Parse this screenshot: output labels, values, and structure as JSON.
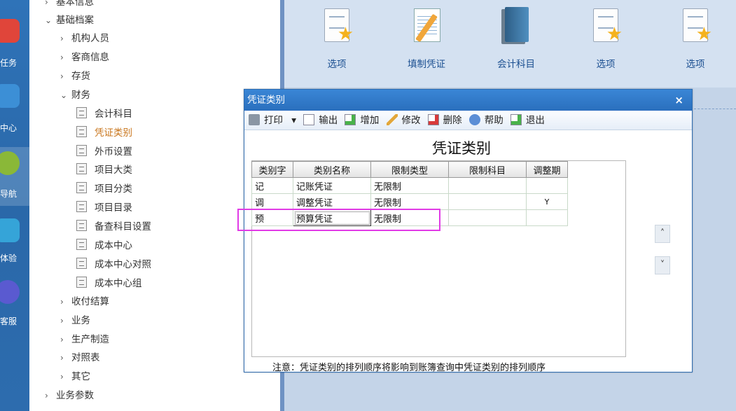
{
  "rail": {
    "items": [
      {
        "label": "任务",
        "color": "#e0453a"
      },
      {
        "label": "中心",
        "color": "#3c8fd6"
      },
      {
        "label": "导航",
        "color": "#8ab838"
      },
      {
        "label": "体验",
        "color": "#35a4d8"
      },
      {
        "label": "客服",
        "color": "#5a5ad0"
      }
    ]
  },
  "tree": {
    "items": [
      {
        "label": "基本信息",
        "chev": "›",
        "level": 1
      },
      {
        "label": "基础档案",
        "chev": "⌄",
        "level": 1
      },
      {
        "label": "机构人员",
        "chev": "›",
        "level": 2
      },
      {
        "label": "客商信息",
        "chev": "›",
        "level": 2
      },
      {
        "label": "存货",
        "chev": "›",
        "level": 2
      },
      {
        "label": "财务",
        "chev": "⌄",
        "level": 2
      },
      {
        "label": "会计科目",
        "level": 3
      },
      {
        "label": "凭证类别",
        "level": 3,
        "selected": true
      },
      {
        "label": "外币设置",
        "level": 3
      },
      {
        "label": "项目大类",
        "level": 3
      },
      {
        "label": "项目分类",
        "level": 3
      },
      {
        "label": "项目目录",
        "level": 3
      },
      {
        "label": "备查科目设置",
        "level": 3
      },
      {
        "label": "成本中心",
        "level": 3
      },
      {
        "label": "成本中心对照",
        "level": 3
      },
      {
        "label": "成本中心组",
        "level": 3
      },
      {
        "label": "收付结算",
        "chev": "›",
        "level": 2
      },
      {
        "label": "业务",
        "chev": "›",
        "level": 2
      },
      {
        "label": "生产制造",
        "chev": "›",
        "level": 2
      },
      {
        "label": "对照表",
        "chev": "›",
        "level": 2
      },
      {
        "label": "其它",
        "chev": "›",
        "level": 2
      },
      {
        "label": "业务参数",
        "chev": "›",
        "level": 1
      }
    ]
  },
  "shortcuts": [
    {
      "label": "选项",
      "icon": "doc-star-icon"
    },
    {
      "label": "填制凭证",
      "icon": "notebook-pencil-icon"
    },
    {
      "label": "会计科目",
      "icon": "book-icon"
    },
    {
      "label": "选项",
      "icon": "doc-star-icon"
    },
    {
      "label": "选项",
      "icon": "doc-star-icon"
    }
  ],
  "dialog": {
    "title": "凭证类别",
    "close": "×",
    "heading": "凭证类别",
    "toolbar": [
      {
        "label": "打印",
        "icon": "printer-icon",
        "dropdown": "▾"
      },
      {
        "label": "输出",
        "icon": "export-icon"
      },
      {
        "label": "增加",
        "icon": "add-icon"
      },
      {
        "label": "修改",
        "icon": "pencil-icon"
      },
      {
        "label": "删除",
        "icon": "delete-icon"
      },
      {
        "label": "帮助",
        "icon": "help-icon"
      },
      {
        "label": "退出",
        "icon": "exit-icon"
      }
    ],
    "columns": [
      "类别字",
      "类别名称",
      "限制类型",
      "限制科目",
      "调整期"
    ],
    "rows": [
      [
        "记",
        "记账凭证",
        "无限制",
        "",
        ""
      ],
      [
        "调",
        "调整凭证",
        "无限制",
        "",
        "Y"
      ],
      [
        "预",
        "预算凭证",
        "无限制",
        "",
        ""
      ]
    ],
    "note": "注意：凭证类别的排列顺序将影响到账簿查询中凭证类别的排列顺序",
    "scroll_up": "˄",
    "scroll_down": "˅"
  },
  "colors": {
    "accent": "#2f6db2",
    "highlight": "#e13be6",
    "selected_text": "#c8741a"
  }
}
